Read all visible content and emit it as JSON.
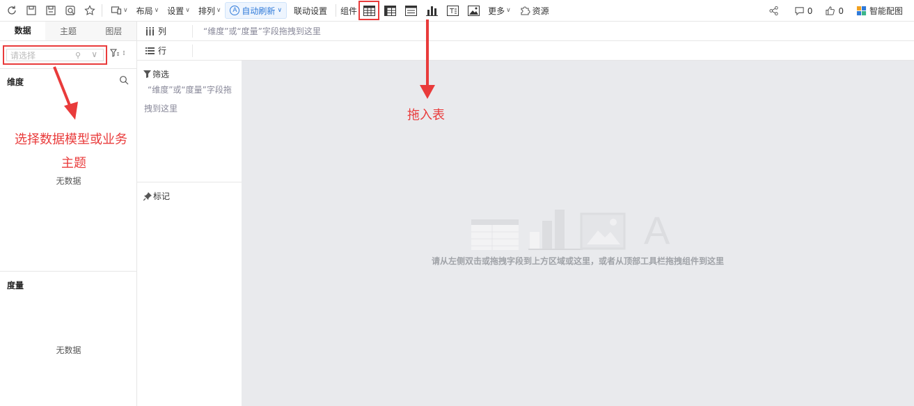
{
  "toolbar": {
    "menus": [
      "布局",
      "设置",
      "排列"
    ],
    "auto_refresh": "自动刷新",
    "linkage": "联动设置",
    "components_label": "组件",
    "more": "更多",
    "resources": "资源",
    "share_count": "0",
    "like_count": "0",
    "smart_color": "智能配图"
  },
  "left_panel": {
    "tabs": [
      "数据",
      "主题",
      "图层"
    ],
    "select_placeholder": "请选择",
    "dimension_title": "维度",
    "dimension_empty": "无数据",
    "measure_title": "度量",
    "measure_empty": "无数据"
  },
  "shelves": {
    "column_label": "列",
    "row_label": "行",
    "column_hint": "“维度”或“度量”字段拖拽到这里"
  },
  "filter": {
    "title": "筛选",
    "hint": "“维度”或“度量”字段拖拽到这里"
  },
  "marks": {
    "title": "标记"
  },
  "canvas": {
    "message": "请从左侧双击或拖拽字段到上方区域或这里，或者从顶部工具栏拖拽组件到这里",
    "placeholder_letter": "A"
  },
  "annotations": {
    "drag_table": "拖入表",
    "select_model_line1": "选择数据模型或业务",
    "select_model_line2": "主题"
  },
  "colors": {
    "accent_blue": "#2f7ad9",
    "annotation_red": "#e93b3b"
  }
}
